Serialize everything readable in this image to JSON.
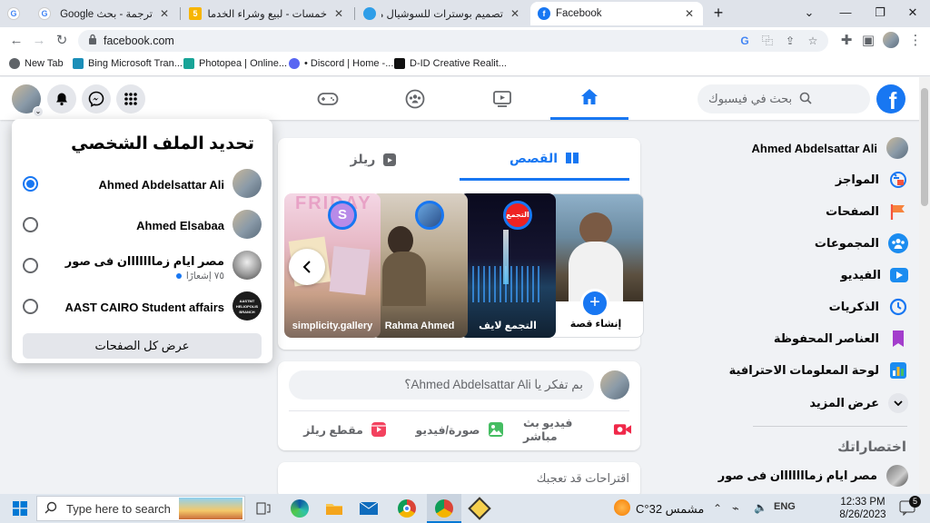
{
  "browser": {
    "tabs": [
      {
        "title": "ترجمة - بحث Google",
        "icon": "google-icon",
        "color": "#4285f4"
      },
      {
        "title": "خمسات - لبيع وشراء الخدمات المصـ",
        "icon": "khamsat-icon",
        "color": "#f7b500",
        "fav_text": "5"
      },
      {
        "title": "تصميم بوسترات للسوشيال ميديا |",
        "icon": "mostaql-icon",
        "color": "#2f9ee8"
      },
      {
        "title": "Facebook",
        "icon": "facebook-icon",
        "color": "#1877f2",
        "active": true
      }
    ],
    "close_glyph": "✕",
    "new_tab_glyph": "+",
    "url": "facebook.com",
    "bookmarks": [
      {
        "label": "New Tab",
        "icon": "pin-icon"
      },
      {
        "label": "Bing Microsoft Tran...",
        "icon": "bing-icon"
      },
      {
        "label": "Photopea | Online...",
        "icon": "photopea-icon"
      },
      {
        "label": "• Discord | Home -...",
        "icon": "discord-icon"
      },
      {
        "label": "D-ID Creative Realit...",
        "icon": "did-icon"
      }
    ]
  },
  "fb": {
    "search_placeholder": "بحث في فيسبوك",
    "logo_letter": "f",
    "sidebar": [
      {
        "label": "Ahmed Abdelsattar Ali",
        "icon": "avatar"
      },
      {
        "label": "المواجز",
        "icon": "feeds-icon"
      },
      {
        "label": "الصفحات",
        "icon": "pages-flag-icon"
      },
      {
        "label": "المجموعات",
        "icon": "groups-icon"
      },
      {
        "label": "الفيديو",
        "icon": "video-icon"
      },
      {
        "label": "الذكريات",
        "icon": "memories-clock-icon"
      },
      {
        "label": "العناصر المحفوظة",
        "icon": "saved-bookmark-icon"
      },
      {
        "label": "لوحة المعلومات الاحترافية",
        "icon": "dashboard-icon"
      },
      {
        "label": "عرض المزيد",
        "icon": "chevron-down-icon"
      }
    ],
    "shortcuts_title": "اختصاراتك",
    "shortcuts": [
      {
        "label": "مصر ايام زمااااااان فى صور"
      }
    ],
    "stories_tabs": {
      "stories": "القصص",
      "reels": "ريلز"
    },
    "stories": [
      {
        "name": "إنشاء قصة",
        "type": "create"
      },
      {
        "name": "التجمع لايف",
        "ring_text": "التجمع"
      },
      {
        "name": "Rahma Ahmed"
      },
      {
        "name": "simplicity.gallery",
        "ring_text": "S",
        "bg_text": "FRIDAY"
      }
    ],
    "composer": {
      "placeholder": "بم تفكر يا Ahmed Abdelsattar Ali؟",
      "actions": [
        {
          "label": "فيديو بث مباشر",
          "icon": "live-video-icon",
          "color": "#f02849"
        },
        {
          "label": "صورة/فيديو",
          "icon": "photo-icon",
          "color": "#45bd62"
        },
        {
          "label": "مقطع ريلز",
          "icon": "reels-icon",
          "color": "#f3425f"
        }
      ]
    },
    "suggestions_title": "اقتراحات قد تعجبك"
  },
  "popup": {
    "title": "تحديد الملف الشخصي",
    "profiles": [
      {
        "name": "Ahmed Abdelsattar Ali",
        "selected": true
      },
      {
        "name": "Ahmed Elsabaa",
        "selected": false
      },
      {
        "name": "مصر ايام زمااااااان فى صور",
        "sub": "٧٥ إشعارًا",
        "selected": false
      },
      {
        "name": "AAST CAIRO Student affairs",
        "selected": false,
        "logo_text": "AASTMT HELIOPOLIS BRANCH"
      }
    ],
    "all_pages_button": "عرض كل الصفحات"
  },
  "taskbar": {
    "search_placeholder": "Type here to search",
    "weather": "مشمس  32°C",
    "time": "12:33 PM",
    "date": "8/26/2023",
    "notifications_count": "5"
  }
}
